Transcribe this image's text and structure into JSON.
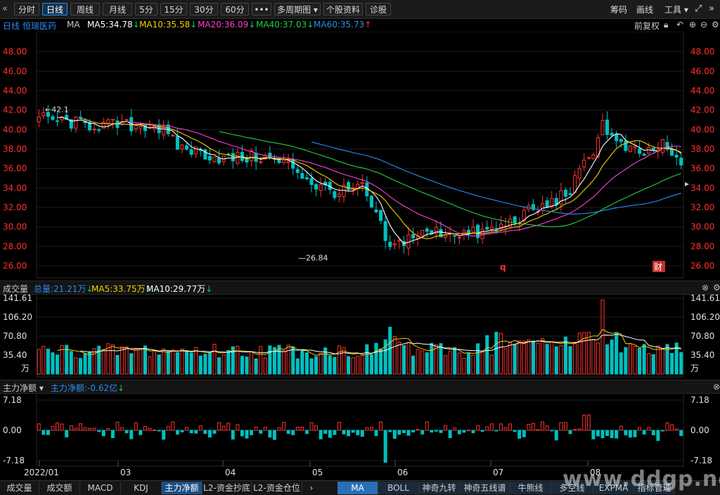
{
  "toolbar": {
    "back_icon": "double-chevron-left-icon",
    "tabs": [
      {
        "label": "分时"
      },
      {
        "label": "日线",
        "active": true
      },
      {
        "label": "周线"
      },
      {
        "label": "月线"
      },
      {
        "label": "5分"
      },
      {
        "label": "15分"
      },
      {
        "label": "30分"
      },
      {
        "label": "60分"
      },
      {
        "label": "•••"
      },
      {
        "label": "多周期图 ▾"
      },
      {
        "label": "个股资料"
      },
      {
        "label": "诊股"
      }
    ],
    "right": {
      "chip": "筹码",
      "draw": "画线",
      "tools": "工具 ▾"
    }
  },
  "info": {
    "period": "日线",
    "stock": "恒瑞医药",
    "indicator": "MA",
    "ma5": "MA5:34.78",
    "ma10": "MA10:35.58",
    "ma20": "MA20:36.09",
    "ma40": "MA40:37.03",
    "ma60": "MA60:35.73",
    "adjust": "前复权"
  },
  "colors": {
    "up": "#ff3333",
    "down": "#00c0c0",
    "ma5": "#ffffff",
    "ma10": "#f0d000",
    "ma20": "#ff40d0",
    "ma40": "#20d040",
    "ma60": "#2a8cf0",
    "axis_text": "#ff3030"
  },
  "price_axis": {
    "ticks": [
      "48.00",
      "46.00",
      "44.00",
      "42.00",
      "40.00",
      "38.00",
      "36.00",
      "34.00",
      "32.00",
      "30.00",
      "28.00",
      "26.00"
    ],
    "high_label": "42.1",
    "low_label": "26.84",
    "marker_q": "q",
    "marker_cai": "财"
  },
  "volume": {
    "title": "成交量",
    "total": "总量:21.21万",
    "ma5": "MA5:33.75万",
    "ma10": "MA10:29.77万",
    "ticks": [
      "141.61",
      "106.20",
      "70.80",
      "35.40"
    ],
    "unit": "万"
  },
  "netflow": {
    "title": "主力净额 ▾",
    "value": "主力净额:-0.62亿",
    "ticks": [
      "7.18",
      "0.00",
      "-7.18"
    ]
  },
  "x_axis": {
    "labels": [
      "2022/01",
      "03",
      "04",
      "05",
      "06",
      "07",
      "08"
    ]
  },
  "bottom_tabs": {
    "left": [
      "成交量",
      "成交额",
      "MACD",
      "KDJ",
      "主力净额",
      "L2-资金抄底",
      "L2-资金仓位"
    ],
    "active_left": "主力净额",
    "right": [
      "MA",
      "BOLL",
      "神奇九转",
      "神奇五线谱",
      "牛熊线",
      "多空线",
      "EXPMA",
      "指标管理"
    ],
    "active_right": "MA"
  },
  "watermark": "www.ddgp.net"
}
